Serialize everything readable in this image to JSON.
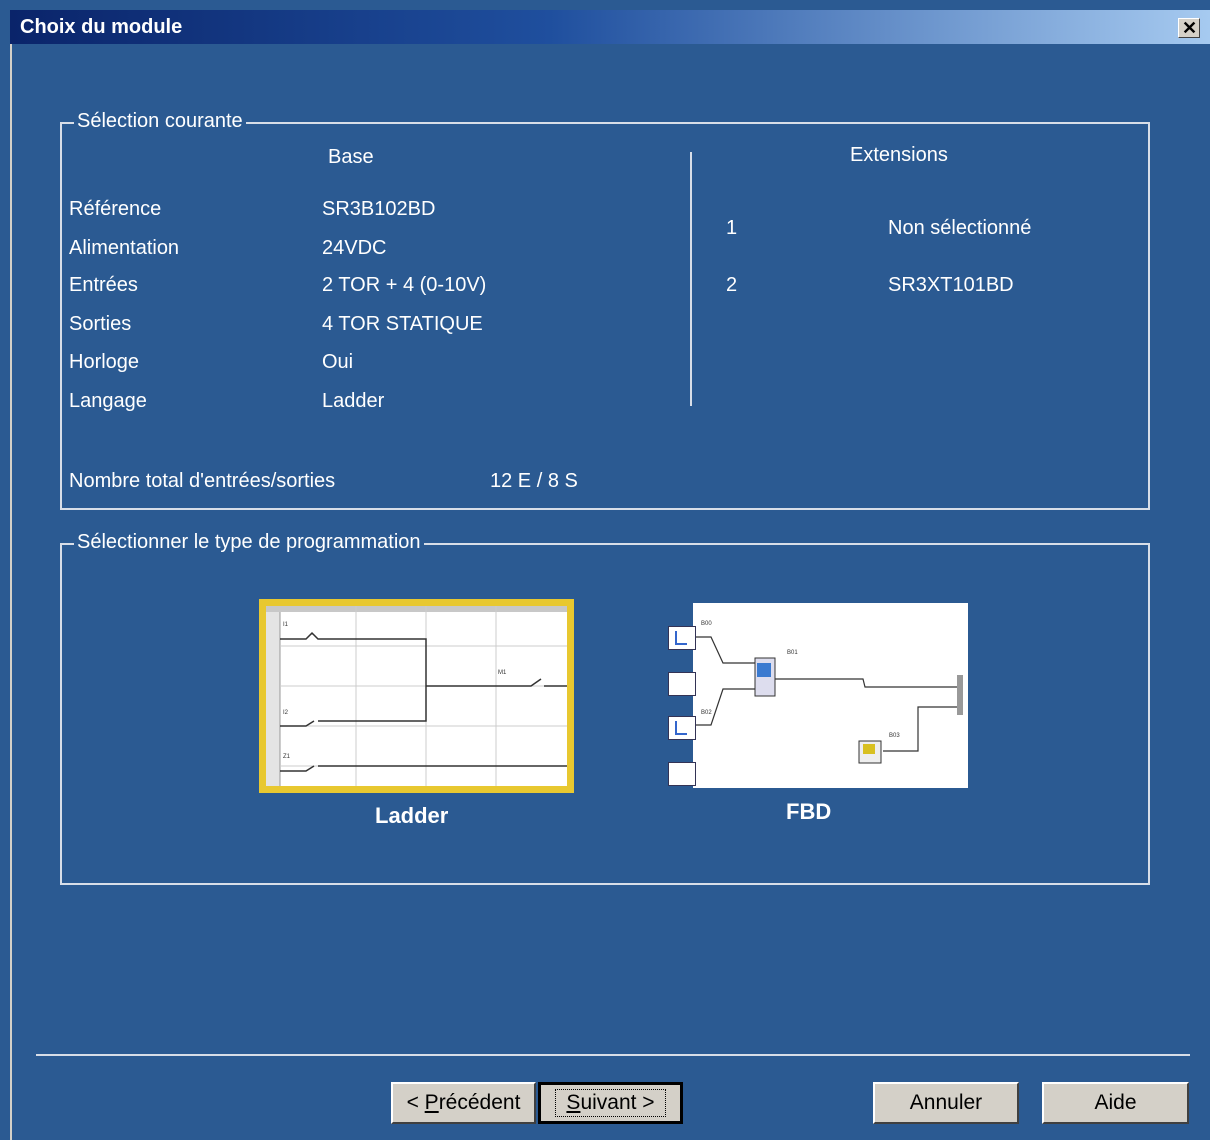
{
  "window": {
    "title": "Choix du module"
  },
  "current_selection": {
    "legend": "Sélection courante",
    "base_header": "Base",
    "extensions_header": "Extensions",
    "rows": [
      {
        "label": "Référence",
        "value": "SR3B102BD"
      },
      {
        "label": "Alimentation",
        "value": "24VDC"
      },
      {
        "label": "Entrées",
        "value": "2 TOR + 4 (0-10V)"
      },
      {
        "label": "Sorties",
        "value": "4 TOR STATIQUE"
      },
      {
        "label": "Horloge",
        "value": "Oui"
      },
      {
        "label": "Langage",
        "value": "Ladder"
      }
    ],
    "extensions": [
      {
        "index": "1",
        "value": "Non sélectionné"
      },
      {
        "index": "2",
        "value": "SR3XT101BD"
      }
    ],
    "total_label": "Nombre total d'entrées/sorties",
    "total_value": "12 E / 8 S"
  },
  "programming": {
    "legend": "Sélectionner le type de programmation",
    "options": [
      {
        "label": "Ladder",
        "selected": true
      },
      {
        "label": "FBD",
        "selected": false
      }
    ],
    "ladder_mini": {
      "m1": "M1",
      "i1": "I1",
      "i2": "I2",
      "z1": "Z1"
    },
    "fbd_mini": {
      "b00": "B00",
      "b01": "B01",
      "b02": "B02",
      "b03": "B03"
    }
  },
  "buttons": {
    "previous": {
      "prefix": "< ",
      "mnemonic": "P",
      "rest": "récédent"
    },
    "next": {
      "mnemonic": "S",
      "rest": "uivant >"
    },
    "cancel": "Annuler",
    "help": "Aide"
  },
  "colors": {
    "background": "#2b5a92",
    "titlebar": "#0a246a",
    "selected_border": "#e8c830"
  }
}
